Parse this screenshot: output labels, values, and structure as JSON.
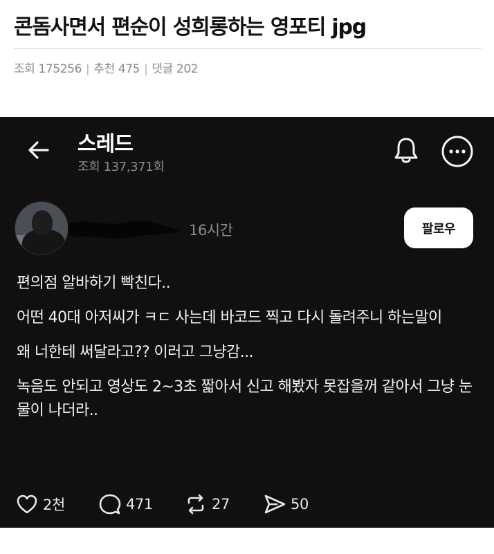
{
  "post": {
    "title": "콘돔사면서 편순이 성희롱하는 영포티 jpg",
    "views_label": "조회",
    "views": "175256",
    "recommend_label": "추천",
    "recommend": "475",
    "comments_label": "댓글",
    "comments": "202",
    "separator": "|"
  },
  "thread": {
    "title": "스레드",
    "views": "조회 137,371회",
    "timestamp": "16시간",
    "follow_label": "팔로우",
    "body": [
      "편의점 알바하기 빡친다..",
      "어떤 40대 아저씨가 ㅋㄷ 사는데 바코드 찍고 다시 돌려주니 하는말이",
      "왜 너한테 써달라고?? 이러고 그냥감...",
      "녹음도 안되고 영상도 2~3초 짧아서 신고 해봤자 못잡을꺼 같아서 그냥 눈물이 나더라.."
    ],
    "actions": {
      "likes": "2천",
      "replies": "471",
      "reposts": "27",
      "shares": "50"
    }
  },
  "icons": [
    "back-arrow-icon",
    "bell-icon",
    "more-icon",
    "heart-icon",
    "comment-icon",
    "repost-icon",
    "share-icon"
  ],
  "colors": {
    "screenshot_bg": "#101010",
    "text": "#f3f3f3",
    "muted": "#8c8c8c",
    "follow_bg": "#ffffff"
  }
}
